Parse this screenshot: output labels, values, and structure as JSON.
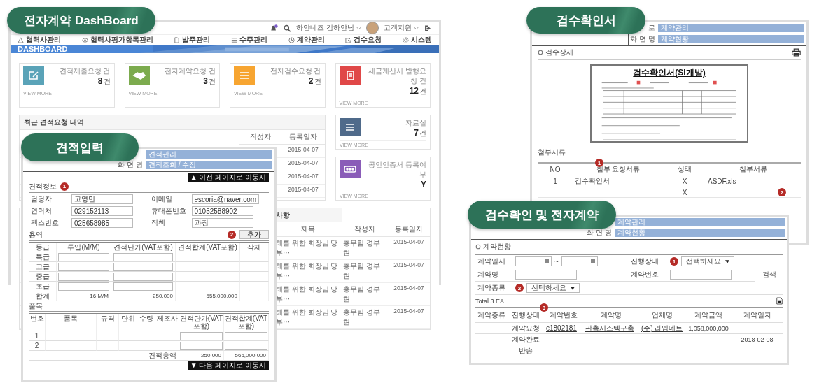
{
  "dashboard": {
    "title": "전자계약 DashBoard",
    "header": {
      "user": "하얀네즈 김하얀님",
      "support": "고객지원"
    },
    "nav": [
      {
        "label": "협력사관리"
      },
      {
        "label": "협력사평가항목관리"
      },
      {
        "label": "발주관리"
      },
      {
        "label": "수주관리"
      },
      {
        "label": "계약관리"
      },
      {
        "label": "검수요청"
      },
      {
        "label": "시스템"
      }
    ],
    "banner": "DASHBOARD",
    "cards": [
      {
        "label": "견적제출요청 건",
        "count": "8",
        "unit": "건",
        "color": "#5aa3b8",
        "more": "VIEW MORE"
      },
      {
        "label": "전자계약요청 건",
        "count": "3",
        "unit": "건",
        "color": "#7cab4e",
        "more": "VIEW MORE"
      },
      {
        "label": "전자검수요청 건",
        "count": "2",
        "unit": "건",
        "color": "#f7a531",
        "more": "VIEW MORE"
      },
      {
        "label": "세금계산서 발행요청 건",
        "count": "12",
        "unit": "건",
        "color": "#e04848",
        "more": "VIEW MORE"
      }
    ],
    "recent": {
      "title": "최근 견적요청 내역",
      "columns": [
        "작성자",
        "등록일자"
      ],
      "dates": [
        "2015-04-07",
        "2015-04-07",
        "2015-04-07",
        "2015-04-07"
      ]
    },
    "side_cards": [
      {
        "label": "자료실",
        "count": "7",
        "unit": "건",
        "color": "#4f6a8a",
        "more": "VIEW MORE"
      },
      {
        "label": "공인인증서 등록여부",
        "count": "Y",
        "color": "#8a5cb8",
        "more": "VIEW MORE"
      }
    ],
    "notices": {
      "title": "사항",
      "columns": [
        "제목",
        "작성자",
        "등록일자"
      ],
      "rows": [
        {
          "title": "해를 위한 회장님 당부···",
          "author": "총무팀 경부현",
          "date": "2015-04-07"
        },
        {
          "title": "해를 위한 회장님 당부···",
          "author": "총무팀 경부현",
          "date": "2015-04-07"
        },
        {
          "title": "해를 위한 회장님 당부···",
          "author": "총무팀 경부현",
          "date": "2015-04-07"
        },
        {
          "title": "해를 위한 회장님 당부···",
          "author": "총무팀 경부현",
          "date": "2015-04-07"
        }
      ]
    }
  },
  "estimate": {
    "title": "견적입력",
    "breadcrumb": [
      {
        "value": "견적관리"
      },
      {
        "label": "화 면 명",
        "value": "견적조회 / 수정"
      }
    ],
    "prev_button": "▲ 이전 페이지로 이동시",
    "info": {
      "title": "견적정보",
      "marker": "1",
      "fields": [
        {
          "label": "담당자",
          "value": "고영민"
        },
        {
          "label": "이메일",
          "value": "escoria@naver.com"
        },
        {
          "label": "연락처",
          "value": "029152113"
        },
        {
          "label": "휴대폰번호",
          "value": "01052588902"
        },
        {
          "label": "팩스번호",
          "value": "025658985"
        },
        {
          "label": "직책",
          "value": "과장"
        }
      ]
    },
    "service": {
      "title": "용역",
      "marker": "2",
      "add_button": "추가",
      "columns": [
        "등급",
        "투입(M/M)",
        "견적단가(VAT포함)",
        "견적합계(VAT포함)",
        "삭제"
      ],
      "grades": [
        "특급",
        "고급",
        "중급",
        "초급"
      ],
      "total": {
        "label": "합계",
        "mm": "16 M/M",
        "price": "250,000",
        "sum": "555,000,000"
      }
    },
    "items": {
      "title": "품목",
      "columns": [
        "번호",
        "품목",
        "규격",
        "단위",
        "수량",
        "제조사",
        "견적단가(VAT포함)",
        "견적합계(VAT포함)"
      ],
      "rows": [
        "1",
        "2"
      ],
      "total": {
        "label": "견적총액",
        "price": "250,000",
        "sum": "565,000,000"
      }
    },
    "next_button": "▼ 다음 페이지로 이동시"
  },
  "inspection": {
    "title": "검수확인서",
    "breadcrumb": [
      {
        "label": "로",
        "value": "계약관리"
      },
      {
        "label": "화 면 명",
        "value": "계약현황"
      }
    ],
    "heading": "검수상세",
    "document_title": "검수확인서(SI개발)",
    "attachments": {
      "title": "첨부서류",
      "marker": "1",
      "columns": [
        "NO",
        "첨부 요청서류",
        "상태",
        "첨부서류"
      ],
      "rows": [
        {
          "no": "1",
          "name": "검수확인서",
          "status": "X",
          "file": "ASDF.xls"
        },
        {
          "status": "X",
          "marker": "2"
        }
      ]
    }
  },
  "contract": {
    "title": "검수확인 및 전자계약",
    "breadcrumb": [
      {
        "value": "계약관리"
      },
      {
        "label": "화 면 명",
        "value": "계약현황"
      }
    ],
    "heading": "계약현황",
    "search": {
      "date_label": "계약일시",
      "date_sep": "~",
      "status_label": "진행상태",
      "status_marker": "1",
      "status_select": "선택하세요",
      "name_label": "계약명",
      "number_label": "계약번호",
      "type_label": "계약종류",
      "type_marker": "2",
      "type_select": "선택하세요",
      "button": "검색"
    },
    "total": "Total 3 EA",
    "table": {
      "marker": "3",
      "columns": [
        "계약종류",
        "진행상태",
        "계약번호",
        "계약명",
        "업체명",
        "계약금액",
        "계약일자"
      ],
      "rows": [
        {
          "status": "계약요청",
          "number": "c1802181",
          "name": "판촉시스템구축",
          "company": "(주) 라임네트",
          "amount": "1,058,000,000"
        },
        {
          "status": "계약완료",
          "date": "2018-02-08"
        },
        {
          "status": "반송"
        }
      ]
    }
  }
}
